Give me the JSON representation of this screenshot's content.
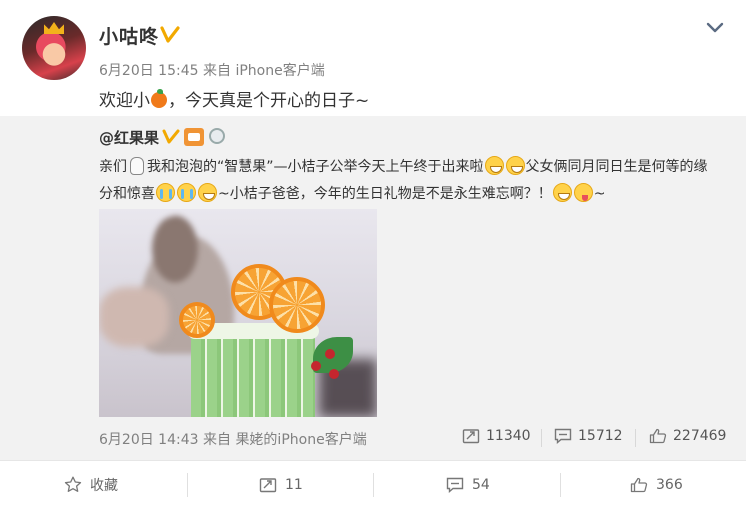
{
  "post": {
    "username": "小咕咚",
    "date": "6月20日 15:45",
    "from_label": "来自",
    "source": "iPhone客户端",
    "text_before": "欢迎小",
    "text_after": "，今天真是个开心的日子~"
  },
  "retweet": {
    "username": "@红果果",
    "text_part1": "亲们",
    "text_part2": "我和泡泡的“智慧果”—小桔子公举今天上午终于出来啦",
    "text_part3": "父女俩同月同日生是何等的缘分和惊喜",
    "text_part4": "~小桔子爸爸，今年的生日礼物是不是永生难忘啊？！",
    "text_part5": "~",
    "date": "6月20日 14:43",
    "from_label": "来自",
    "source": "果姥的iPhone客户端",
    "reposts": "11340",
    "comments": "15712",
    "likes": "227469"
  },
  "actions": {
    "favorite_label": "收藏",
    "repost_count": "11",
    "comment_count": "54",
    "like_count": "366"
  },
  "colors": {
    "verified_gold": "#f2a900",
    "link_orange": "#eb7350",
    "meta_gray": "#808080"
  }
}
